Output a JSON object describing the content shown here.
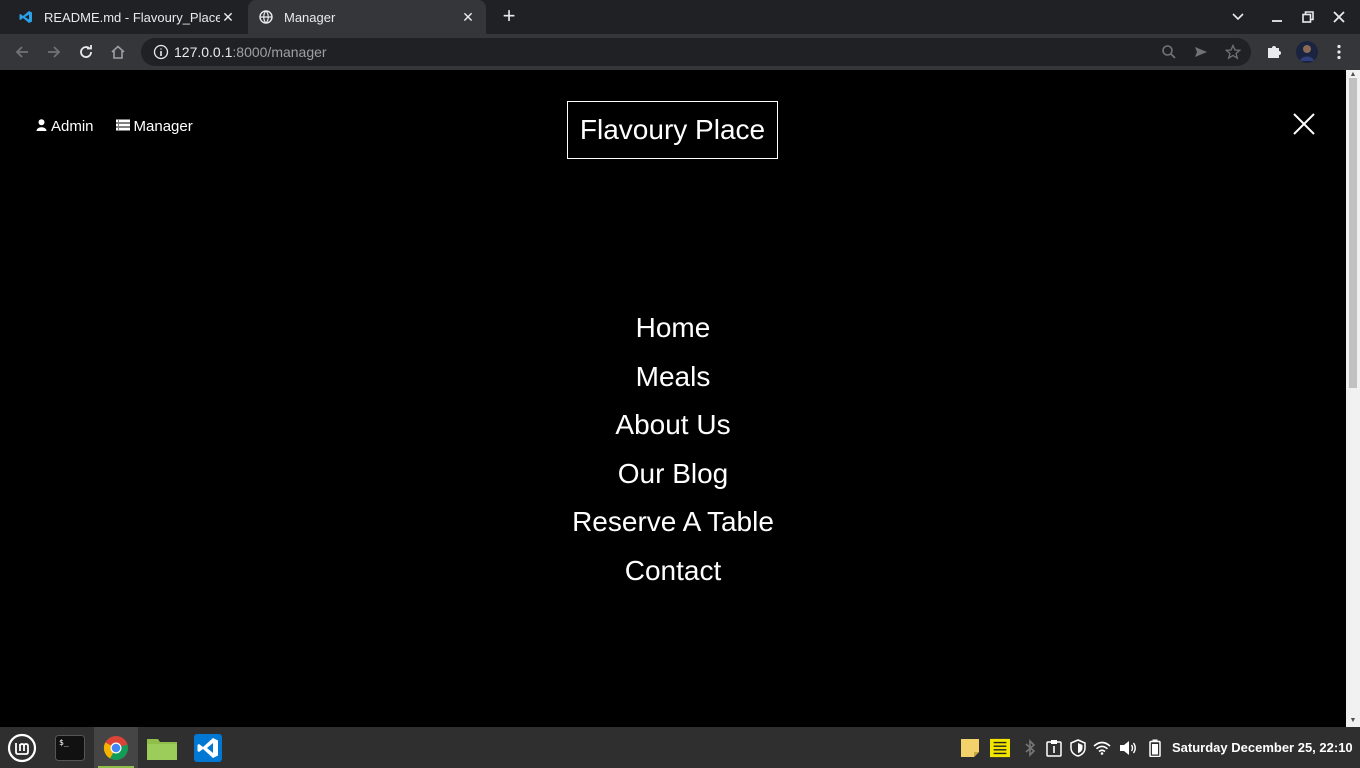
{
  "browser": {
    "tabs": [
      {
        "title": "README.md - Flavoury_Place",
        "icon": "vscode-icon",
        "active": false
      },
      {
        "title": "Manager",
        "icon": "globe-icon",
        "active": true
      }
    ],
    "url_host": "127.0.0.1",
    "url_path": ":8000/manager"
  },
  "page": {
    "top_links": [
      {
        "label": "Admin",
        "icon": "user-icon"
      },
      {
        "label": "Manager",
        "icon": "menu-list-icon"
      }
    ],
    "brand": "Flavoury Place",
    "menu": [
      "Home",
      "Meals",
      "About Us",
      "Our Blog",
      "Reserve A Table",
      "Contact"
    ]
  },
  "taskbar": {
    "clock": "Saturday December 25, 22:10",
    "accent": "#8fbf4a"
  }
}
